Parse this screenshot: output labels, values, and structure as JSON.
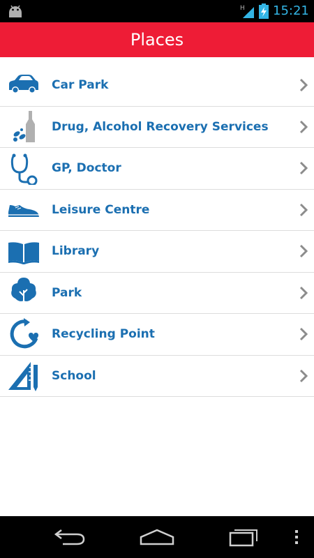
{
  "status_bar": {
    "time": "15:21",
    "network_type": "H",
    "icons": [
      "android-icon",
      "signal-icon",
      "battery-charging-icon"
    ],
    "clock_color": "#33b5e5"
  },
  "header": {
    "title": "Places",
    "background_color": "#ee1c36"
  },
  "places": {
    "items": [
      {
        "label": "Car Park",
        "icon": "car-icon"
      },
      {
        "label": "Drug, Alcohol Recovery Services",
        "icon": "bottle-pills-icon"
      },
      {
        "label": "GP, Doctor",
        "icon": "stethoscope-icon"
      },
      {
        "label": "Leisure Centre",
        "icon": "trainer-shoe-icon"
      },
      {
        "label": "Library",
        "icon": "open-book-icon"
      },
      {
        "label": "Park",
        "icon": "tree-icon"
      },
      {
        "label": "Recycling Point",
        "icon": "recycle-heart-icon"
      },
      {
        "label": "School",
        "icon": "set-square-pencil-icon"
      }
    ],
    "text_color": "#1b6fb1",
    "icon_color": "#1b6fb1"
  },
  "nav_bar": {
    "buttons": [
      "back-icon",
      "home-icon",
      "recent-apps-icon",
      "overflow-menu-icon"
    ]
  }
}
